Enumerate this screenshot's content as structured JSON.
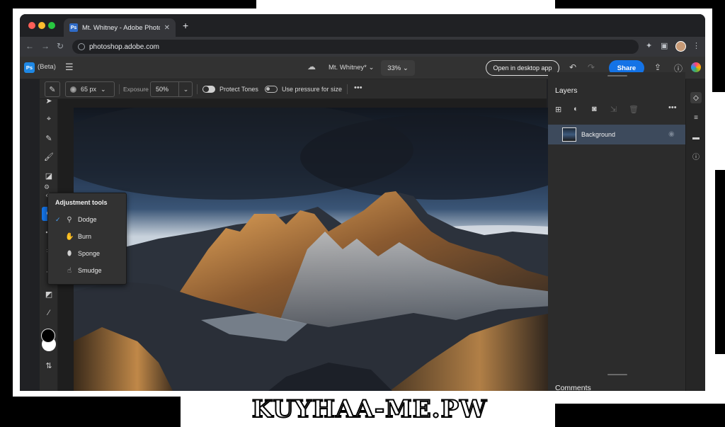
{
  "browser": {
    "tab_title": "Mt. Whitney - Adobe Photoshop",
    "tab_favicon": "Ps",
    "url": "photoshop.adobe.com",
    "new_tab_glyph": "+",
    "tab_close_glyph": "✕"
  },
  "appbar": {
    "logo": "Ps",
    "beta_label": "(Beta)",
    "document_name": "Mt. Whitney*",
    "zoom": "33%",
    "open_desktop_label": "Open in desktop app",
    "share_label": "Share"
  },
  "options": {
    "brush_size": "65 px",
    "exposure_label": "Exposure",
    "exposure_value": "50%",
    "protect_tones_label": "Protect Tones",
    "protect_tones_on": true,
    "pressure_label": "Use pressure for size",
    "pressure_on": false
  },
  "popover": {
    "title": "Adjustment tools",
    "items": [
      {
        "label": "Dodge",
        "selected": true,
        "icon": "dodge-icon"
      },
      {
        "label": "Burn",
        "selected": false,
        "icon": "burn-icon"
      },
      {
        "label": "Sponge",
        "selected": false,
        "icon": "sponge-icon"
      },
      {
        "label": "Smudge",
        "selected": false,
        "icon": "smudge-icon"
      }
    ]
  },
  "layers": {
    "title": "Layers",
    "items": [
      {
        "name": "Background"
      }
    ]
  },
  "comments": {
    "title": "Comments"
  },
  "watermark": {
    "text": "KUYHAA-ME.PW"
  },
  "colors": {
    "accent": "#1473e6",
    "foreground": "#000000",
    "background": "#ffffff",
    "layer_selected": "#3d4a5c"
  }
}
